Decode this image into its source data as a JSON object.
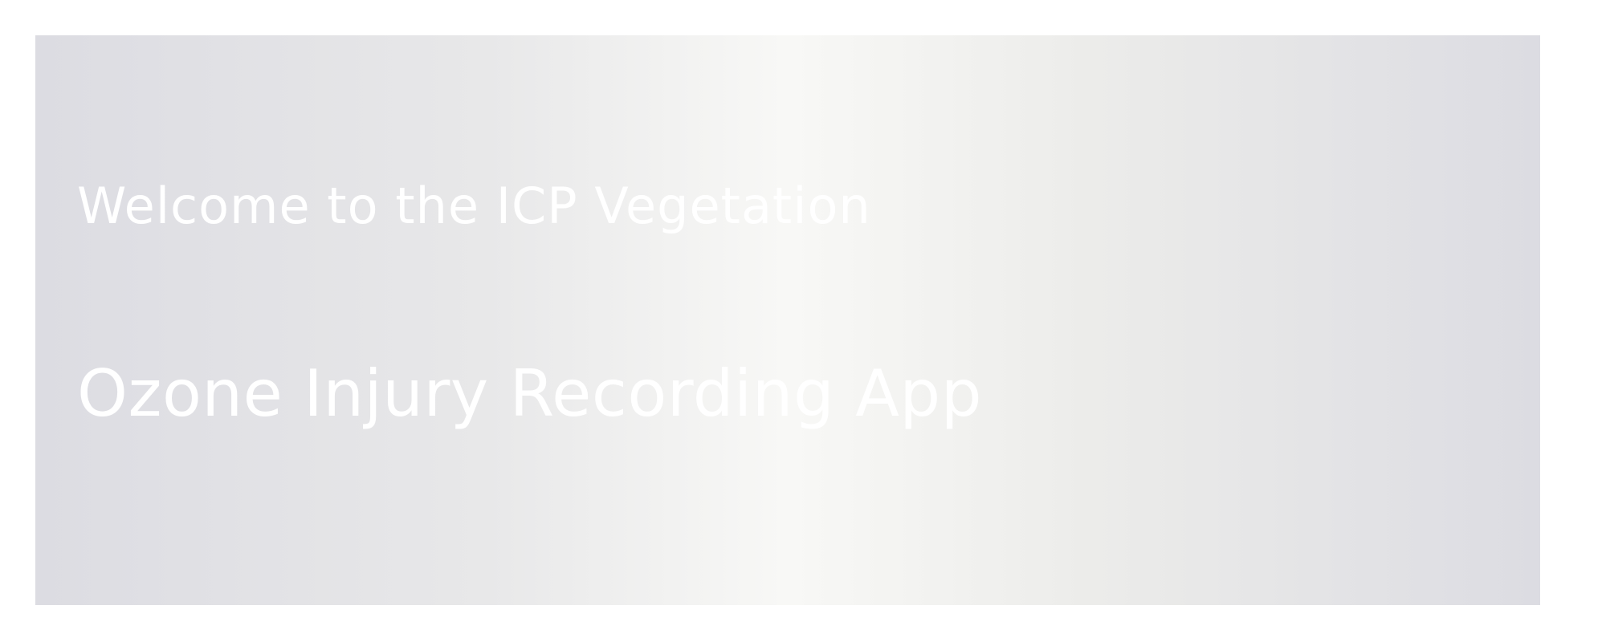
{
  "banner": {
    "title_line1": "Welcome to the ICP Vegetation",
    "title_line2": "Ozone Injury Recording App"
  },
  "colors": {
    "background": "#ffffff",
    "banner_gradient_edge": "#dcdce2",
    "banner_gradient_center": "#f8f8f6",
    "text": "#ffffff"
  }
}
